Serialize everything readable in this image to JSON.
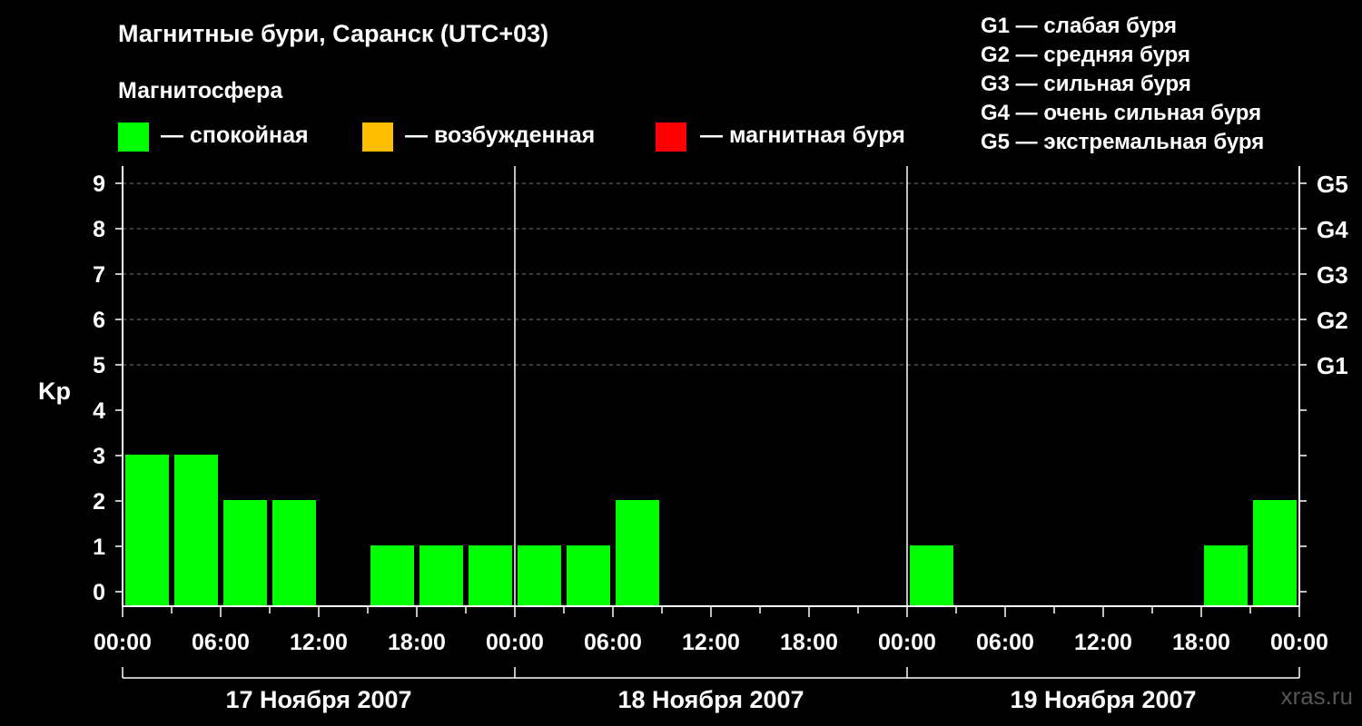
{
  "header": {
    "title": "Магнитные бури, Саранск (UTC+03)",
    "subtitle": "Магнитосфера"
  },
  "legend": {
    "calm": {
      "label": "— спокойная",
      "color": "#00ff00"
    },
    "excited": {
      "label": "— возбужденная",
      "color": "#ffbf00"
    },
    "storm": {
      "label": "— магнитная буря",
      "color": "#ff0000"
    }
  },
  "g_scale": [
    "G1 — слабая буря",
    "G2 — средняя буря",
    "G3 — сильная буря",
    "G4 — очень сильная буря",
    "G5 — экстремальная буря"
  ],
  "watermark": "xras.ru",
  "chart_data": {
    "type": "bar",
    "ylabel": "Kp",
    "ylim": [
      0,
      9
    ],
    "y_ticks": [
      "0",
      "1",
      "2",
      "3",
      "4",
      "5",
      "6",
      "7",
      "8",
      "9"
    ],
    "right_axis_labels": [
      {
        "kp": 5,
        "label": "G1"
      },
      {
        "kp": 6,
        "label": "G2"
      },
      {
        "kp": 7,
        "label": "G3"
      },
      {
        "kp": 8,
        "label": "G4"
      },
      {
        "kp": 9,
        "label": "G5"
      }
    ],
    "grid": "dashed horizontal at Kp 5–9",
    "x_tick_labels": [
      "00:00",
      "06:00",
      "12:00",
      "18:00",
      "00:00",
      "06:00",
      "12:00",
      "18:00",
      "00:00",
      "06:00",
      "12:00",
      "18:00",
      "00:00"
    ],
    "days": [
      "17 Ноября 2007",
      "18 Ноября 2007",
      "19 Ноября 2007"
    ],
    "interval_hours": 3,
    "series": [
      {
        "values": [
          3,
          3,
          2,
          2,
          0,
          1,
          1,
          1,
          1,
          1,
          2,
          0,
          0,
          0,
          0,
          0,
          1,
          0,
          0,
          0,
          0,
          0,
          1,
          2
        ]
      }
    ],
    "bar_color": "#00ff00"
  }
}
